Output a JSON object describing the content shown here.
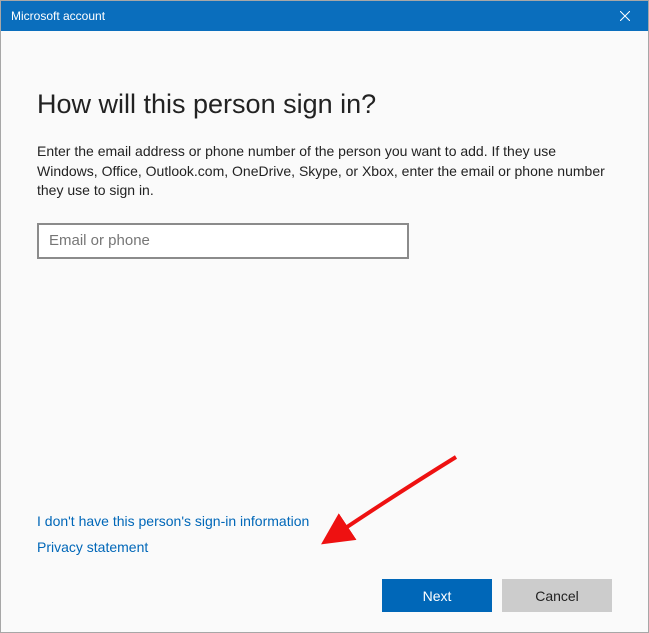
{
  "titlebar": {
    "title": "Microsoft account"
  },
  "heading": "How will this person sign in?",
  "instructions": "Enter the email address or phone number of the person you want to add. If they use Windows, Office, Outlook.com, OneDrive, Skype, or Xbox, enter the email or phone number they use to sign in.",
  "email_field": {
    "placeholder": "Email or phone",
    "value": ""
  },
  "links": {
    "no_signin_info": "I don't have this person's sign-in information",
    "privacy": "Privacy statement"
  },
  "buttons": {
    "next": "Next",
    "cancel": "Cancel"
  }
}
